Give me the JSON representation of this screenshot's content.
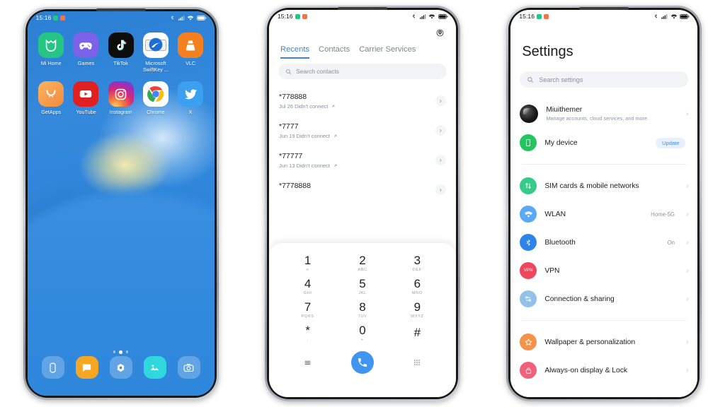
{
  "statusbar": {
    "time": "15:16",
    "icons": [
      "dot-green",
      "dot-orange",
      "bluetooth",
      "signal",
      "wifi",
      "battery"
    ]
  },
  "phone1": {
    "name": "home-screen",
    "apps_row1": [
      {
        "label": "Mi Home",
        "icon": "mi-home-icon",
        "color": "#25c685"
      },
      {
        "label": "Games",
        "icon": "games-icon",
        "color": "#7b62e8"
      },
      {
        "label": "TikTok",
        "icon": "tiktok-icon",
        "color": "#0d0d0d"
      },
      {
        "label": "Microsoft SwiftKey ...",
        "icon": "swiftkey-icon",
        "color": "#ffffff"
      },
      {
        "label": "VLC",
        "icon": "vlc-icon",
        "color": "#f58020"
      }
    ],
    "apps_row2": [
      {
        "label": "GetApps",
        "icon": "getapps-icon",
        "color": "#f59a52"
      },
      {
        "label": "YouTube",
        "icon": "youtube-icon",
        "color": "#e02020"
      },
      {
        "label": "Instagram",
        "icon": "instagram-icon",
        "color": "#c93aa8"
      },
      {
        "label": "Chrome",
        "icon": "chrome-icon",
        "color": "#ffffff"
      },
      {
        "label": "X",
        "icon": "x-twitter-icon",
        "color": "#3ba0ef"
      }
    ],
    "page_dots": {
      "count": 3,
      "active_index": 1
    },
    "dock": [
      {
        "icon": "phone-dock-icon",
        "color": "rgba(255,255,255,0.22)"
      },
      {
        "icon": "messages-dock-icon",
        "color": "#f5a623"
      },
      {
        "icon": "browser-dock-icon",
        "color": "rgba(255,255,255,0.22)"
      },
      {
        "icon": "gallery-dock-icon",
        "color": "#2fd8dd"
      },
      {
        "icon": "camera-dock-icon",
        "color": "rgba(255,255,255,0.22)"
      }
    ]
  },
  "phone2": {
    "name": "dialer-screen",
    "settings_icon": "gear-icon",
    "tabs": [
      {
        "label": "Recents",
        "active": true
      },
      {
        "label": "Contacts",
        "active": false
      },
      {
        "label": "Carrier Services",
        "active": false
      }
    ],
    "search": {
      "placeholder": "Search contacts",
      "icon": "search-icon"
    },
    "calls": [
      {
        "number": "*778888",
        "meta": "Jul 26 Didn't connect"
      },
      {
        "number": "*7777",
        "meta": "Jun 19 Didn't connect"
      },
      {
        "number": "*77777",
        "meta": "Jun 13 Didn't connect"
      },
      {
        "number": "*7778888",
        "meta": ""
      }
    ],
    "keypad": [
      {
        "num": "1",
        "sub": "∞"
      },
      {
        "num": "2",
        "sub": "ABC"
      },
      {
        "num": "3",
        "sub": "DEF"
      },
      {
        "num": "4",
        "sub": "GHI"
      },
      {
        "num": "5",
        "sub": "JKL"
      },
      {
        "num": "6",
        "sub": "MNO"
      },
      {
        "num": "7",
        "sub": "PQRS"
      },
      {
        "num": "8",
        "sub": "TUV"
      },
      {
        "num": "9",
        "sub": "WXYZ"
      },
      {
        "num": "*",
        "sub": ","
      },
      {
        "num": "0",
        "sub": "+"
      },
      {
        "num": "#",
        "sub": ""
      }
    ],
    "actions": {
      "menu_icon": "hamburger-menu-icon",
      "call_icon": "call-icon",
      "dialpad_icon": "dialpad-grid-icon",
      "accent": "#4294f1"
    }
  },
  "phone3": {
    "name": "settings-screen",
    "title": "Settings",
    "search": {
      "placeholder": "Search settings",
      "icon": "search-icon"
    },
    "account": {
      "name": "Miuithemer",
      "subtitle": "Manage accounts, cloud services, and more",
      "avatar": "user-avatar"
    },
    "my_device": {
      "label": "My device",
      "badge": "Update",
      "icon": "phone-icon",
      "color": "#22c55e"
    },
    "items": [
      {
        "label": "SIM cards & mobile networks",
        "value": "",
        "icon": "sim-icon",
        "color": "#35cb8a"
      },
      {
        "label": "WLAN",
        "value": "Home-5G",
        "icon": "wifi-icon",
        "color": "#5aa9f5"
      },
      {
        "label": "Bluetooth",
        "value": "On",
        "icon": "bluetooth-icon",
        "color": "#2f84e8"
      },
      {
        "label": "VPN",
        "value": "",
        "icon": "vpn-icon",
        "color": "#f0465c"
      },
      {
        "label": "Connection & sharing",
        "value": "",
        "icon": "connection-sharing-icon",
        "color": "#93c2e8"
      }
    ],
    "items2": [
      {
        "label": "Wallpaper & personalization",
        "value": "",
        "icon": "star-icon",
        "color": "#f5924a"
      },
      {
        "label": "Always-on display & Lock",
        "value": "",
        "icon": "lock-screen-icon",
        "color": "#f2607a"
      }
    ]
  }
}
